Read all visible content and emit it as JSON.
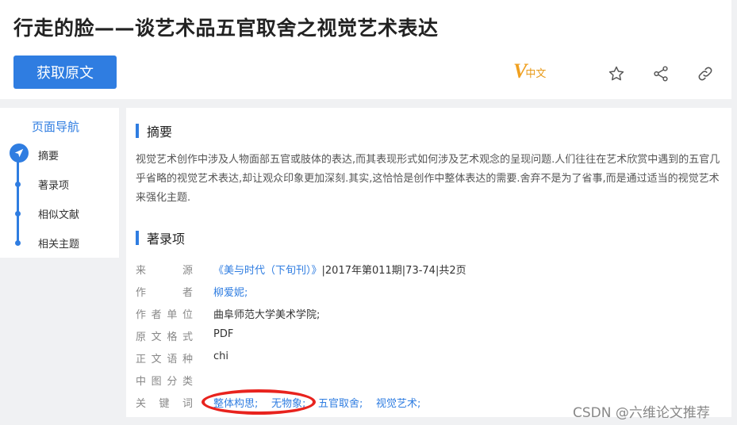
{
  "header": {
    "title": "行走的脸——谈艺术品五官取舍之视觉艺术表达",
    "get_original_label": "获取原文",
    "logo_v": "V",
    "logo_text": "中文"
  },
  "nav": {
    "title": "页面导航",
    "items": [
      {
        "label": "摘要"
      },
      {
        "label": "著录项"
      },
      {
        "label": "相似文献"
      },
      {
        "label": "相关主题"
      }
    ]
  },
  "abstract": {
    "heading": "摘要",
    "text": "视觉艺术创作中涉及人物面部五官或肢体的表达,而其表现形式如何涉及艺术观念的呈现问题.人们往往在艺术欣赏中遇到的五官几乎省略的视觉艺术表达,却让观众印象更加深刻.其实,这恰恰是创作中整体表达的需要.舍弃不是为了省事,而是通过适当的视觉艺术来强化主题."
  },
  "record": {
    "heading": "著录项",
    "source_label": [
      "来",
      "源"
    ],
    "source_link": "《美与时代（下旬刊）》",
    "source_rest": "|2017年第011期|73-74|共2页",
    "author_label": [
      "作",
      "者"
    ],
    "author_value": "柳爱妮;",
    "org_label": [
      "作",
      "者",
      "单",
      "位"
    ],
    "org_value": "曲阜师范大学美术学院;",
    "format_label": [
      "原",
      "文",
      "格",
      "式"
    ],
    "format_value": "PDF",
    "lang_label": [
      "正",
      "文",
      "语",
      "种"
    ],
    "lang_value": "chi",
    "clc_label": [
      "中",
      "图",
      "分",
      "类"
    ],
    "kw_label": [
      "关",
      "键",
      "词"
    ],
    "keywords": [
      "整体构思;",
      "无物象;",
      "五官取舍;",
      "视觉艺术;"
    ]
  },
  "watermark": "CSDN @六维论文推荐",
  "colors": {
    "accent": "#2f7de1",
    "logo": "#f0a020",
    "annotation": "#e8231e"
  }
}
